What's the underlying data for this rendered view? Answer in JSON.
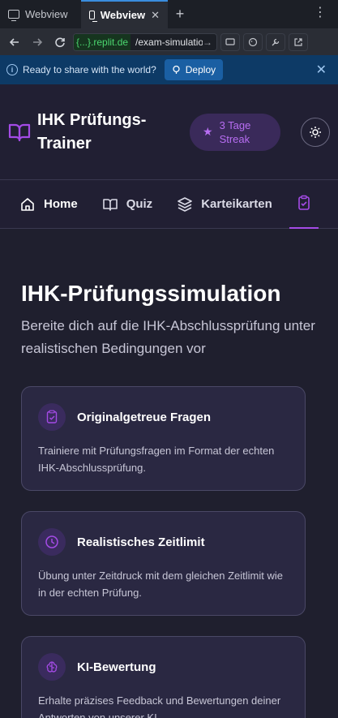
{
  "browser": {
    "tabs": [
      {
        "label": "Webview",
        "active": false
      },
      {
        "label": "Webview",
        "active": true
      }
    ],
    "url_host": "{...}.replit.de",
    "url_path": "/exam-simulation"
  },
  "banner": {
    "message": "Ready to share with the world?",
    "deploy_label": "Deploy"
  },
  "header": {
    "brand": "IHK Prüfungs-Trainer",
    "streak": "3 Tage Streak"
  },
  "nav": {
    "items": [
      {
        "label": "Home",
        "icon": "home-icon"
      },
      {
        "label": "Quiz",
        "icon": "book-icon"
      },
      {
        "label": "Karteikarten",
        "icon": "layers-icon"
      }
    ],
    "active_icon": "clipboard-check-icon"
  },
  "main": {
    "title": "IHK-Prüfungssimulation",
    "subtitle": "Bereite dich auf die IHK-Abschlussprüfung unter realistischen Bedingungen vor",
    "cards": [
      {
        "title": "Originalgetreue Fragen",
        "description": "Trainiere mit Prüfungsfragen im Format der echten IHK-Abschlussprüfung.",
        "icon": "clipboard-check-icon"
      },
      {
        "title": "Realistisches Zeitlimit",
        "description": "Übung unter Zeitdruck mit dem gleichen Zeitlimit wie in der echten Prüfung.",
        "icon": "clock-icon"
      },
      {
        "title": "KI-Bewertung",
        "description": "Erhalte präzises Feedback und Bewertungen deiner Antworten von unserer KI.",
        "icon": "brain-icon"
      }
    ]
  },
  "colors": {
    "accent": "#a44be6",
    "background": "#1f1f2e",
    "card": "#2a2842"
  }
}
